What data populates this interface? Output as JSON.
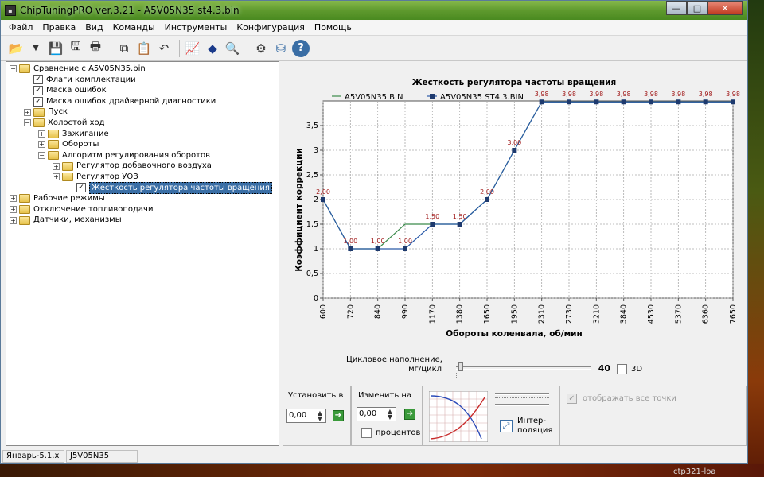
{
  "window": {
    "title": "ChipTuningPRO ver.3.21  -  A5V05N35 st4.3.bin",
    "controls": {
      "minimize": "—",
      "maximize": "□",
      "close": "✕"
    }
  },
  "menu": [
    "Файл",
    "Правка",
    "Вид",
    "Команды",
    "Инструменты",
    "Конфигурация",
    "Помощь"
  ],
  "toolbar": {
    "buttons": [
      "open-icon",
      "dropdown-arrow-icon",
      "save-icon",
      "save-as-icon",
      "print-icon",
      "copy-icon",
      "paste-icon",
      "undo-icon",
      "chart-view-icon",
      "info-icon",
      "search-icon",
      "settings-icon",
      "database-icon",
      "help-icon"
    ]
  },
  "tree": [
    {
      "label": "Сравнение с A5V05N35.bin",
      "level": 0,
      "kind": "folder",
      "expander": "−"
    },
    {
      "label": "Флаги комплектации",
      "level": 1,
      "kind": "doc",
      "expander": ""
    },
    {
      "label": "Маска ошибок",
      "level": 1,
      "kind": "doc",
      "expander": ""
    },
    {
      "label": "Маска ошибок драйверной диагностики",
      "level": 1,
      "kind": "doc",
      "expander": ""
    },
    {
      "label": "Пуск",
      "level": 1,
      "kind": "folder",
      "expander": "+"
    },
    {
      "label": "Холостой ход",
      "level": 1,
      "kind": "folder",
      "expander": "−"
    },
    {
      "label": "Зажигание",
      "level": 2,
      "kind": "folder",
      "expander": "+"
    },
    {
      "label": "Обороты",
      "level": 2,
      "kind": "folder",
      "expander": "+"
    },
    {
      "label": "Алгоритм регулирования оборотов",
      "level": 2,
      "kind": "folder",
      "expander": "−"
    },
    {
      "label": "Регулятор добавочного воздуха",
      "level": 3,
      "kind": "folder",
      "expander": "+"
    },
    {
      "label": "Регулятор УОЗ",
      "level": 3,
      "kind": "folder",
      "expander": "+"
    },
    {
      "label": "Жесткость регулятора частоты вращения",
      "level": 4,
      "kind": "doc",
      "expander": "",
      "selected": true
    },
    {
      "label": "Рабочие режимы",
      "level": 0,
      "kind": "folder",
      "expander": "+"
    },
    {
      "label": "Отключение топливоподачи",
      "level": 0,
      "kind": "folder",
      "expander": "+"
    },
    {
      "label": "Датчики, механизмы",
      "level": 0,
      "kind": "folder",
      "expander": "+"
    }
  ],
  "chart_data": {
    "type": "line",
    "title": "Жесткость регулятора частоты вращения",
    "xlabel": "Обороты коленвала, об/мин",
    "ylabel": "Коэффициент коррекции",
    "categories": [
      "600",
      "720",
      "840",
      "990",
      "1170",
      "1380",
      "1650",
      "1950",
      "2310",
      "2730",
      "3210",
      "3840",
      "4530",
      "5370",
      "6360",
      "7650"
    ],
    "ylim": [
      0,
      4
    ],
    "yticks": [
      "0",
      "0,5",
      "1",
      "1,5",
      "2",
      "2,5",
      "3",
      "3,5"
    ],
    "grid": true,
    "legend_position": "top",
    "series": [
      {
        "name": "A5V05N35.BIN",
        "color": "#3a8a4a",
        "markers": false,
        "values": [
          2,
          1,
          1,
          1.5,
          1.5,
          1.5,
          2,
          3,
          3.98,
          3.98,
          3.98,
          3.98,
          3.98,
          3.98,
          3.98,
          3.98
        ]
      },
      {
        "name": "A5V05N35 ST4.3.BIN",
        "color": "#2a5aa8",
        "markers": true,
        "values": [
          2,
          1,
          1,
          1,
          1.5,
          1.5,
          2,
          3,
          3.98,
          3.98,
          3.98,
          3.98,
          3.98,
          3.98,
          3.98,
          3.98
        ]
      }
    ],
    "data_labels": [
      "2,00",
      "1,00",
      "1,00",
      "1,00",
      "1,50",
      "1,50",
      "2,00",
      "3,00",
      "3,98",
      "3,98",
      "3,98",
      "3,98",
      "3,98",
      "3,98",
      "3,98",
      "3,98"
    ],
    "data_label_color": "#a01818"
  },
  "cycle_fill": {
    "label": "Цикловое наполнение,\nмг/цикл",
    "value": "40",
    "slider_fraction": 0.02,
    "check3d_label": "3D"
  },
  "set_group": {
    "label": "Установить в",
    "value": "0,00"
  },
  "change_group": {
    "label": "Изменить на",
    "value": "0,00",
    "percent_label": "процентов"
  },
  "interp": {
    "label": "Интер-\nполяция"
  },
  "show_points": {
    "label": "отображать все точки",
    "checked": true
  },
  "status": {
    "cell1": "Январь-5.1.x",
    "cell2": "J5V05N35"
  },
  "taskbar": {
    "label": "ctp321-loa"
  }
}
